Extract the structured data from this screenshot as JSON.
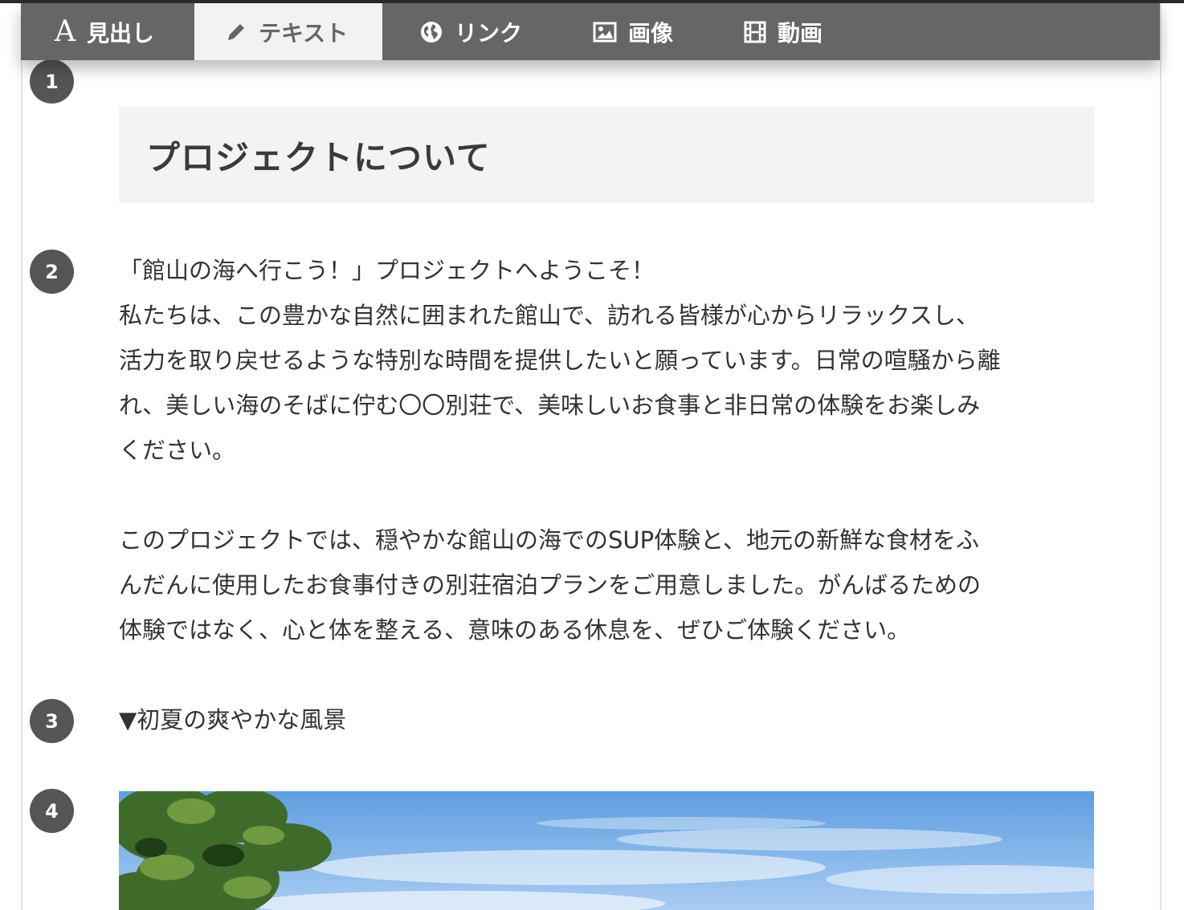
{
  "toolbar": {
    "items": [
      {
        "label": "見出し",
        "icon": "letter-a-icon",
        "glyph": "A",
        "active": false
      },
      {
        "label": "テキスト",
        "icon": "pencil-icon",
        "active": true
      },
      {
        "label": "リンク",
        "icon": "globe-icon",
        "active": false
      },
      {
        "label": "画像",
        "icon": "image-icon",
        "active": false
      },
      {
        "label": "動画",
        "icon": "film-icon",
        "active": false
      }
    ],
    "background": "#666666",
    "active_background": "#f2f2f2"
  },
  "blocks": [
    {
      "number": "1",
      "type": "heading",
      "text": "プロジェクトについて"
    },
    {
      "number": "2",
      "type": "text",
      "paragraphs": [
        [
          "「館山の海へ行こう！」プロジェクトへようこそ！",
          "私たちは、この豊かな自然に囲まれた館山で、訪れる皆様が心からリラックスし、",
          "活力を取り戻せるような特別な時間を提供したいと願っています。日常の喧騒から離",
          "れ、美しい海のそばに佇む〇〇別荘で、美味しいお食事と非日常の体験をお楽しみ",
          "ください。"
        ],
        [
          "このプロジェクトでは、穏やかな館山の海でのSUP体験と、地元の新鮮な食材をふ",
          "んだんに使用したお食事付きの別荘宿泊プランをご用意しました。がんばるための",
          "体験ではなく、心と体を整える、意味のある休息を、ぜひご体験ください。"
        ]
      ]
    },
    {
      "number": "3",
      "type": "text",
      "text": "▼初夏の爽やかな風景"
    },
    {
      "number": "4",
      "type": "image"
    }
  ],
  "colors": {
    "badge": "#555555",
    "heading_bg": "#f3f3f3",
    "text": "#333333"
  }
}
